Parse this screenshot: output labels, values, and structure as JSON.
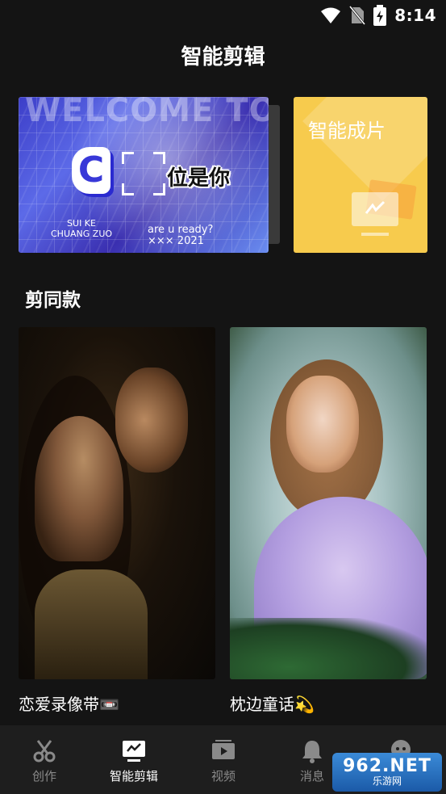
{
  "status_bar": {
    "time": "8:14"
  },
  "header": {
    "title": "智能剪辑"
  },
  "banner": {
    "watermark_text": "WELCOME TO",
    "logo_letter": "C",
    "title": "位是你",
    "sub_left": "SUI KE\nCHUANG ZUO",
    "sub_right": "are u ready?\n××× 2021"
  },
  "smart_card": {
    "label": "智能成片"
  },
  "section": {
    "title": "剪同款"
  },
  "templates": [
    {
      "label": "恋爱录像带📼"
    },
    {
      "label": "枕边童话💫"
    }
  ],
  "bottom_nav": [
    {
      "label": "创作",
      "icon": "scissors-icon",
      "active": false
    },
    {
      "label": "智能剪辑",
      "icon": "smart-edit-icon",
      "active": true
    },
    {
      "label": "视频",
      "icon": "video-icon",
      "active": false
    },
    {
      "label": "消息",
      "icon": "bell-icon",
      "active": false
    }
  ],
  "watermark": {
    "big": "962.NET",
    "small": "乐游网"
  }
}
